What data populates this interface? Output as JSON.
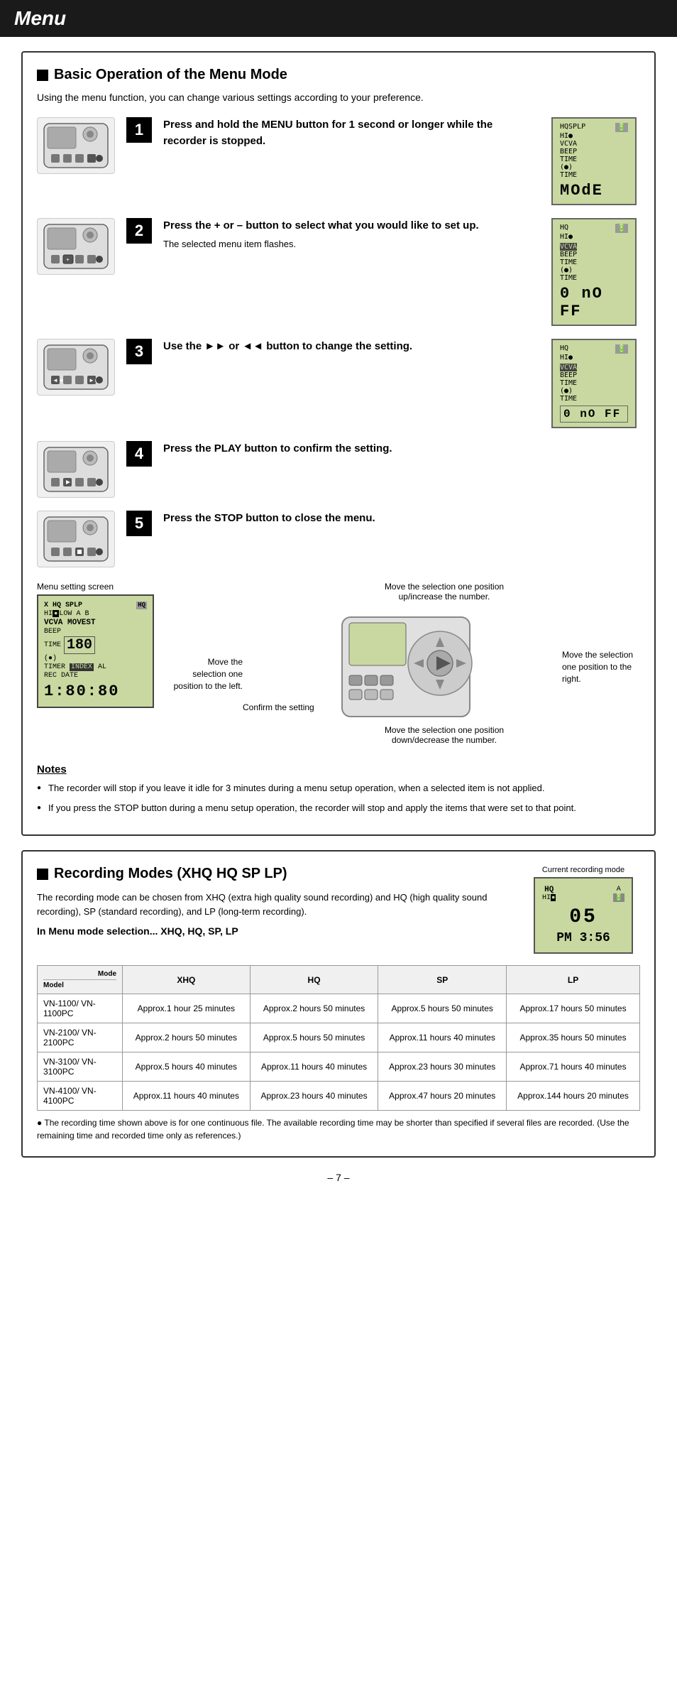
{
  "page": {
    "title": "Menu",
    "page_number": "– 7 –"
  },
  "basic_operation": {
    "section_title": "Basic Operation of the Menu Mode",
    "subtitle": "Using the menu function, you can change various settings according to your preference.",
    "steps": [
      {
        "number": "1",
        "instruction": "Press and hold the MENU button for 1 second or longer while the recorder is stopped.",
        "sub": "",
        "display_lines": [
          "HQSPLP",
          "HI",
          "VCVA",
          "BEEP",
          "TIME",
          "(●)",
          "TIME"
        ],
        "display_big": "MOdE"
      },
      {
        "number": "2",
        "instruction": "Press the + or – button to select what you would like to set up.",
        "sub": "The selected menu item flashes.",
        "display_lines": [
          "HQ",
          "HI",
          "VCVA",
          "BEEP",
          "TIME",
          "(●)",
          "TIME"
        ],
        "display_big": "0 nO FF"
      },
      {
        "number": "3",
        "instruction": "Use the ►► or ◄◄ button to change the setting.",
        "sub": "",
        "display_lines": [
          "HQ",
          "HI",
          "VCVA",
          "BEEP",
          "TIME",
          "(●)",
          "TIME"
        ],
        "display_big": "0 nO FF"
      },
      {
        "number": "4",
        "instruction": "Press the PLAY button to confirm the setting.",
        "sub": "",
        "display_lines": [],
        "display_big": ""
      },
      {
        "number": "5",
        "instruction": "Press the STOP button to close the menu.",
        "sub": "",
        "display_lines": [],
        "display_big": ""
      }
    ],
    "menu_setting_screen_label": "Menu setting screen",
    "menu_screen": {
      "rows": [
        "X HQ SPLP HQ",
        "HI LOW A B",
        "VCVA MOVEST",
        "BEEP",
        "TIME 180",
        "(●)",
        "TIMER INDEX AL",
        "REC DATE",
        "1:80:80"
      ]
    },
    "annotations": {
      "top": "Move the selection one position up/increase the number.",
      "left": "Move the selection one position to the left.",
      "right": "Move the selection one position to the right.",
      "bottom": "Move the selection one position down/decrease the number.",
      "confirm": "Confirm the setting"
    }
  },
  "notes": {
    "title": "Notes",
    "items": [
      "The recorder will stop if you leave it idle for 3 minutes during a menu setup operation, when a selected item is not applied.",
      "If you press the STOP button during a menu setup operation, the recorder will stop and apply the items that were set to that point."
    ]
  },
  "recording_modes": {
    "section_title": "Recording Modes (XHQ HQ SP LP)",
    "current_recording_label": "Current recording mode",
    "description": "The recording mode can be chosen from XHQ (extra high quality sound recording) and HQ (high quality sound recording), SP (standard recording), and LP (long-term recording).",
    "menu_mode_label": "In Menu mode selection... XHQ, HQ, SP, LP",
    "display": {
      "top_left": "HQ",
      "top_right": "A",
      "icon": "🔋",
      "number": "05",
      "time": "PM  3:56"
    },
    "table": {
      "headers": [
        "Mode / Model",
        "XHQ",
        "HQ",
        "SP",
        "LP"
      ],
      "rows": [
        {
          "model": "VN-1100/ VN-1100PC",
          "xhq": "Approx.1 hour 25 minutes",
          "hq": "Approx.2 hours 50 minutes",
          "sp": "Approx.5 hours 50 minutes",
          "lp": "Approx.17 hours 50 minutes"
        },
        {
          "model": "VN-2100/ VN-2100PC",
          "xhq": "Approx.2 hours 50 minutes",
          "hq": "Approx.5 hours 50 minutes",
          "sp": "Approx.11 hours 40 minutes",
          "lp": "Approx.35 hours 50 minutes"
        },
        {
          "model": "VN-3100/ VN-3100PC",
          "xhq": "Approx.5 hours 40 minutes",
          "hq": "Approx.11 hours 40 minutes",
          "sp": "Approx.23 hours 30 minutes",
          "lp": "Approx.71 hours 40 minutes"
        },
        {
          "model": "VN-4100/ VN-4100PC",
          "xhq": "Approx.11 hours 40 minutes",
          "hq": "Approx.23 hours 40 minutes",
          "sp": "Approx.47 hours 20 minutes",
          "lp": "Approx.144 hours 20 minutes"
        }
      ]
    },
    "table_note": "The recording time shown above is for one continuous file. The available recording time may be shorter than specified if several files are recorded. (Use the remaining time and recorded time only as references.)"
  }
}
